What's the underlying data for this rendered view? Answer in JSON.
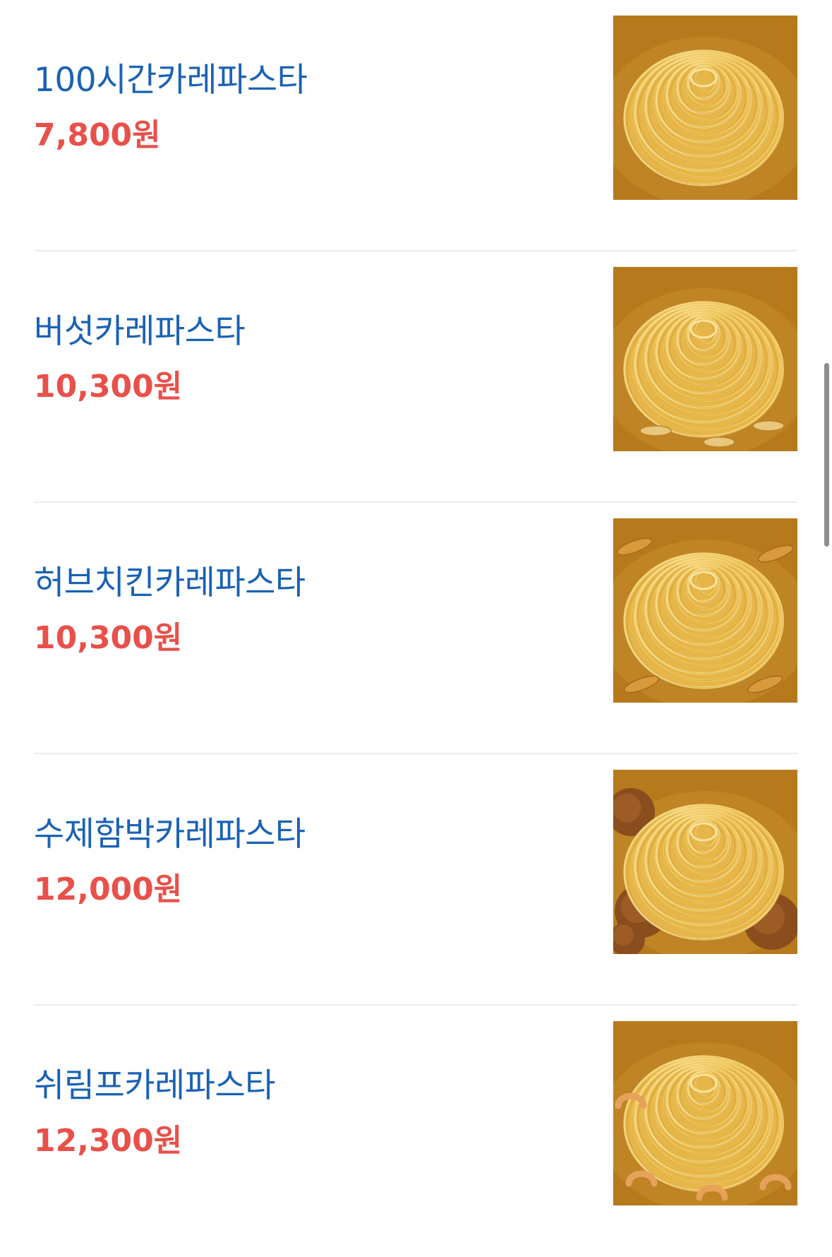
{
  "menu": {
    "items": [
      {
        "name": "100시간카레파스타",
        "price": "7,800원",
        "image": "curry-pasta-photo",
        "toppings": "none"
      },
      {
        "name": "버섯카레파스타",
        "price": "10,300원",
        "image": "mushroom-curry-pasta-photo",
        "toppings": "mushroom"
      },
      {
        "name": "허브치킨카레파스타",
        "price": "10,300원",
        "image": "herb-chicken-curry-pasta-photo",
        "toppings": "chicken"
      },
      {
        "name": "수제함박카레파스타",
        "price": "12,000원",
        "image": "hamburg-steak-curry-pasta-photo",
        "toppings": "hamburg"
      },
      {
        "name": "쉬림프카레파스타",
        "price": "12,300원",
        "image": "shrimp-curry-pasta-photo",
        "toppings": "shrimp"
      }
    ]
  },
  "colors": {
    "name": "#1a62b4",
    "price": "#e8504a",
    "divider": "#ebebeb",
    "sauce": "#b67a1c",
    "noodle": "#f0c760"
  }
}
